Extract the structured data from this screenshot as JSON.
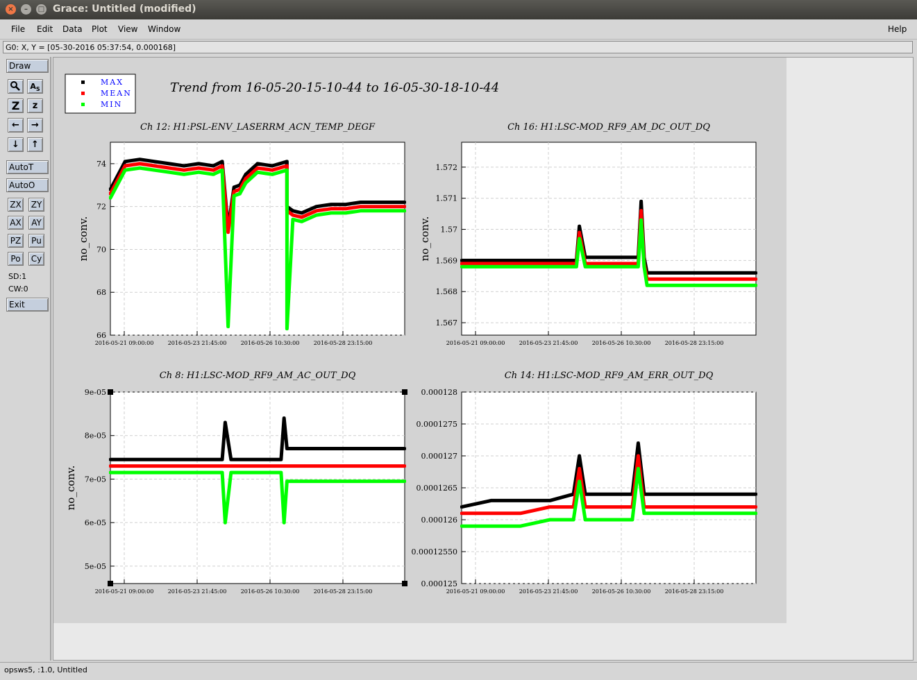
{
  "window": {
    "title": "Grace: Untitled (modified)"
  },
  "menubar": {
    "file": "File",
    "edit": "Edit",
    "data": "Data",
    "plot": "Plot",
    "view": "View",
    "window": "Window",
    "help": "Help"
  },
  "locator": "G0: X, Y = [05-30-2016 05:37:54, 0.000168]",
  "toolbox": {
    "draw": "Draw",
    "autot": "AutoT",
    "autoo": "AutoO",
    "zx": "ZX",
    "zy": "ZY",
    "ax": "AX",
    "ay": "AY",
    "pz": "PZ",
    "pu": "Pu",
    "po": "Po",
    "cy": "Cy",
    "sd": "SD:1",
    "cw": "CW:0",
    "exit": "Exit",
    "icons": [
      "zoom-icon",
      "autoscale-text-icon",
      "zoom-z-icon",
      "zoom-out-z-icon",
      "left-arrow-icon",
      "right-arrow-icon",
      "down-arrow-icon",
      "up-arrow-icon"
    ]
  },
  "statusbar": "opsws5, :1.0, Untitled",
  "graph_title": "Trend from 16-05-20-15-10-44 to 16-05-30-18-10-44",
  "legend": [
    {
      "label": "MAX",
      "color": "#000000"
    },
    {
      "label": "MEAN",
      "color": "#ff0000"
    },
    {
      "label": "MIN",
      "color": "#00ff00"
    }
  ],
  "colors": {
    "max": "#000000",
    "mean": "#ff0000",
    "min": "#00ff00",
    "legend_text": "#0000ff"
  },
  "chart_data": [
    {
      "type": "scatter",
      "title": "Ch 12: H1:PSL-ENV_LASERRM_ACN_TEMP_DEGF",
      "ylabel": "no_conv.",
      "xticks": [
        "2016-05-21 09:00:00",
        "2016-05-23 21:45:00",
        "2016-05-26 10:30:00",
        "2016-05-28 23:15:00"
      ],
      "yticks": [
        "66",
        "68",
        "70",
        "72",
        "74"
      ],
      "ylim": [
        66,
        75
      ],
      "series": [
        {
          "name": "MAX",
          "x": [
            0,
            0.05,
            0.1,
            0.15,
            0.2,
            0.25,
            0.3,
            0.35,
            0.38,
            0.4,
            0.42,
            0.44,
            0.46,
            0.5,
            0.55,
            0.6,
            0.6,
            0.62,
            0.65,
            0.7,
            0.75,
            0.8,
            0.85,
            0.9,
            0.95,
            1.0
          ],
          "y": [
            72.8,
            74.1,
            74.2,
            74.1,
            74.0,
            73.9,
            74.0,
            73.9,
            74.1,
            71.0,
            72.9,
            73.0,
            73.5,
            74.0,
            73.9,
            74.1,
            72.0,
            71.8,
            71.7,
            72.0,
            72.1,
            72.1,
            72.2,
            72.2,
            72.2,
            72.2
          ]
        },
        {
          "name": "MEAN",
          "x": [
            0,
            0.05,
            0.1,
            0.15,
            0.2,
            0.25,
            0.3,
            0.35,
            0.38,
            0.4,
            0.42,
            0.44,
            0.46,
            0.5,
            0.55,
            0.6,
            0.6,
            0.62,
            0.65,
            0.7,
            0.75,
            0.8,
            0.85,
            0.9,
            0.95,
            1.0
          ],
          "y": [
            72.6,
            73.9,
            74.0,
            73.9,
            73.8,
            73.7,
            73.8,
            73.7,
            73.9,
            70.8,
            72.7,
            72.8,
            73.3,
            73.8,
            73.7,
            73.9,
            71.8,
            71.6,
            71.5,
            71.8,
            71.9,
            71.9,
            72.0,
            72.0,
            72.0,
            72.0
          ]
        },
        {
          "name": "MIN",
          "x": [
            0,
            0.05,
            0.1,
            0.15,
            0.2,
            0.25,
            0.3,
            0.35,
            0.38,
            0.4,
            0.42,
            0.44,
            0.46,
            0.5,
            0.55,
            0.6,
            0.6,
            0.62,
            0.65,
            0.7,
            0.75,
            0.8,
            0.85,
            0.9,
            0.95,
            1.0
          ],
          "y": [
            72.4,
            73.7,
            73.8,
            73.7,
            73.6,
            73.5,
            73.6,
            73.5,
            73.7,
            66.4,
            72.5,
            72.6,
            73.1,
            73.6,
            73.5,
            73.7,
            66.3,
            71.4,
            71.3,
            71.6,
            71.7,
            71.7,
            71.8,
            71.8,
            71.8,
            71.8
          ]
        }
      ]
    },
    {
      "type": "scatter",
      "title": "Ch 16: H1:LSC-MOD_RF9_AM_DC_OUT_DQ",
      "ylabel": "no_conv.",
      "xticks": [
        "2016-05-21 09:00:00",
        "2016-05-23 21:45:00",
        "2016-05-26 10:30:00",
        "2016-05-28 23:15:00"
      ],
      "yticks": [
        "1.567",
        "1.568",
        "1.569",
        "1.57",
        "1.571",
        "1.572"
      ],
      "ylim": [
        1.5666,
        1.5728
      ],
      "series": [
        {
          "name": "MAX",
          "x": [
            0,
            0.1,
            0.2,
            0.3,
            0.39,
            0.4,
            0.42,
            0.5,
            0.6,
            0.61,
            0.62,
            0.63,
            0.7,
            0.8,
            0.9,
            1.0
          ],
          "y": [
            1.569,
            1.569,
            1.569,
            1.569,
            1.569,
            1.5701,
            1.5691,
            1.5691,
            1.5691,
            1.5709,
            1.5691,
            1.5686,
            1.5686,
            1.5686,
            1.5686,
            1.5686
          ]
        },
        {
          "name": "MEAN",
          "x": [
            0,
            0.1,
            0.2,
            0.3,
            0.39,
            0.4,
            0.42,
            0.5,
            0.6,
            0.61,
            0.62,
            0.63,
            0.7,
            0.8,
            0.9,
            1.0
          ],
          "y": [
            1.5689,
            1.5689,
            1.5689,
            1.5689,
            1.5689,
            1.5699,
            1.5689,
            1.5689,
            1.5689,
            1.5706,
            1.5689,
            1.5684,
            1.5684,
            1.5684,
            1.5684,
            1.5684
          ]
        },
        {
          "name": "MIN",
          "x": [
            0,
            0.1,
            0.2,
            0.3,
            0.39,
            0.4,
            0.42,
            0.5,
            0.6,
            0.61,
            0.62,
            0.63,
            0.7,
            0.8,
            0.9,
            1.0
          ],
          "y": [
            1.5688,
            1.5688,
            1.5688,
            1.5688,
            1.5688,
            1.5697,
            1.5688,
            1.5688,
            1.5688,
            1.5703,
            1.5688,
            1.5682,
            1.5682,
            1.5682,
            1.5682,
            1.5682
          ]
        }
      ]
    },
    {
      "type": "scatter",
      "title": "Ch 8: H1:LSC-MOD_RF9_AM_AC_OUT_DQ",
      "ylabel": "no_conv.",
      "xticks": [
        "2016-05-21 09:00:00",
        "2016-05-23 21:45:00",
        "2016-05-26 10:30:00",
        "2016-05-28 23:15:00"
      ],
      "yticks": [
        "5e-05",
        "6e-05",
        "7e-05",
        "8e-05",
        "9e-05"
      ],
      "ylim": [
        4.6e-05,
        9e-05
      ],
      "series": [
        {
          "name": "MAX",
          "x": [
            0,
            0.1,
            0.2,
            0.3,
            0.38,
            0.39,
            0.41,
            0.5,
            0.58,
            0.59,
            0.6,
            0.7,
            0.8,
            0.9,
            1.0
          ],
          "y": [
            7.45e-05,
            7.45e-05,
            7.45e-05,
            7.45e-05,
            7.45e-05,
            8.3e-05,
            7.45e-05,
            7.45e-05,
            7.45e-05,
            8.4e-05,
            7.7e-05,
            7.7e-05,
            7.7e-05,
            7.7e-05,
            7.7e-05
          ]
        },
        {
          "name": "MEAN",
          "x": [
            0,
            0.1,
            0.2,
            0.3,
            0.38,
            0.39,
            0.41,
            0.5,
            0.58,
            0.59,
            0.6,
            0.7,
            0.8,
            0.9,
            1.0
          ],
          "y": [
            7.3e-05,
            7.3e-05,
            7.3e-05,
            7.3e-05,
            7.3e-05,
            7.3e-05,
            7.3e-05,
            7.3e-05,
            7.3e-05,
            7.3e-05,
            7.3e-05,
            7.3e-05,
            7.3e-05,
            7.3e-05,
            7.3e-05
          ]
        },
        {
          "name": "MIN",
          "x": [
            0,
            0.1,
            0.2,
            0.3,
            0.38,
            0.39,
            0.41,
            0.5,
            0.58,
            0.59,
            0.6,
            0.7,
            0.8,
            0.9,
            1.0
          ],
          "y": [
            7.15e-05,
            7.15e-05,
            7.15e-05,
            7.15e-05,
            7.15e-05,
            6e-05,
            7.15e-05,
            7.15e-05,
            7.15e-05,
            6e-05,
            6.95e-05,
            6.95e-05,
            6.95e-05,
            6.95e-05,
            6.95e-05
          ]
        }
      ]
    },
    {
      "type": "scatter",
      "title": "Ch 14: H1:LSC-MOD_RF9_AM_ERR_OUT_DQ",
      "ylabel": "",
      "xticks": [
        "2016-05-21 09:00:00",
        "2016-05-23 21:45:00",
        "2016-05-26 10:30:00",
        "2016-05-28 23:15:00"
      ],
      "yticks": [
        "0.000125",
        "0.00012550",
        "0.0001255",
        "0.000126",
        "0.0001265",
        "0.000127",
        "0.0001275",
        "0.000128"
      ],
      "ylim": [
        0.000125,
        0.000128
      ],
      "series": [
        {
          "name": "MAX",
          "x": [
            0,
            0.1,
            0.2,
            0.3,
            0.38,
            0.4,
            0.42,
            0.5,
            0.58,
            0.6,
            0.62,
            0.7,
            0.8,
            0.9,
            1.0
          ],
          "y": [
            0.0001262,
            0.0001263,
            0.0001263,
            0.0001263,
            0.0001264,
            0.000127,
            0.0001264,
            0.0001264,
            0.0001264,
            0.0001272,
            0.0001264,
            0.0001264,
            0.0001264,
            0.0001264,
            0.0001264
          ]
        },
        {
          "name": "MEAN",
          "x": [
            0,
            0.1,
            0.2,
            0.3,
            0.38,
            0.4,
            0.42,
            0.5,
            0.58,
            0.6,
            0.62,
            0.7,
            0.8,
            0.9,
            1.0
          ],
          "y": [
            0.0001261,
            0.0001261,
            0.0001261,
            0.0001262,
            0.0001262,
            0.0001268,
            0.0001262,
            0.0001262,
            0.0001262,
            0.000127,
            0.0001262,
            0.0001262,
            0.0001262,
            0.0001262,
            0.0001262
          ]
        },
        {
          "name": "MIN",
          "x": [
            0,
            0.1,
            0.2,
            0.3,
            0.38,
            0.4,
            0.42,
            0.5,
            0.58,
            0.6,
            0.62,
            0.7,
            0.8,
            0.9,
            1.0
          ],
          "y": [
            0.0001259,
            0.0001259,
            0.0001259,
            0.000126,
            0.000126,
            0.0001266,
            0.000126,
            0.000126,
            0.000126,
            0.0001268,
            0.0001261,
            0.0001261,
            0.0001261,
            0.0001261,
            0.0001261
          ]
        }
      ]
    }
  ]
}
